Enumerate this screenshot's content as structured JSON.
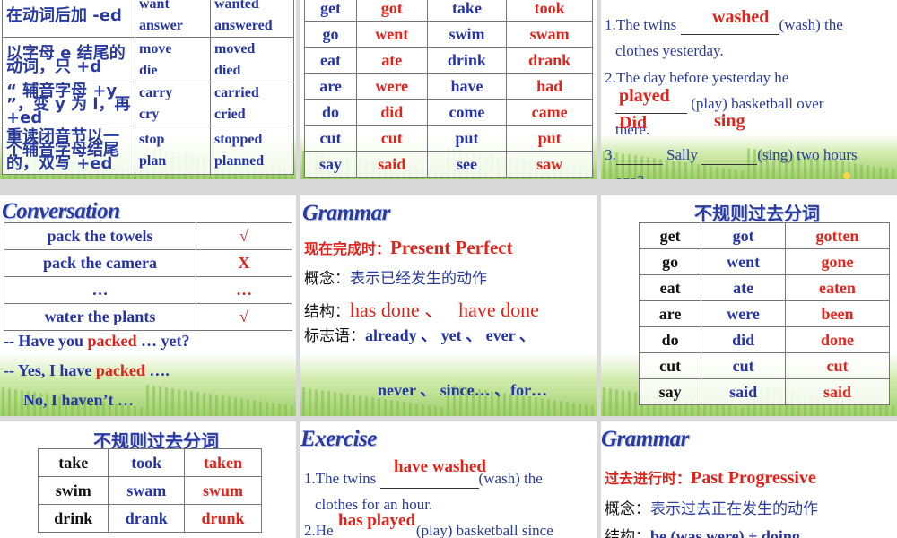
{
  "s1": {
    "rows": [
      {
        "rule": "在动词后加 -ed",
        "w1": "want",
        "w2": "answer",
        "p1": "wanted",
        "p2": "answered"
      },
      {
        "rule": "以字母 e  结尾的动词，只 +d",
        "w1": "move",
        "w2": "die",
        "p1": "moved",
        "p2": "died"
      },
      {
        "rule": "“  辅音字母 +y ”，变 y  为 i，再 +ed",
        "w1": "carry",
        "w2": "cry",
        "p1": "carried",
        "p2": "cried"
      },
      {
        "rule": "重读闭音节以一个辅音字母结尾的，双写 +ed",
        "w1": "stop",
        "w2": "plan",
        "p1": "stopped",
        "p2": "planned"
      }
    ]
  },
  "s2": {
    "rows": [
      [
        "get",
        "got",
        "take",
        "took"
      ],
      [
        "go",
        "went",
        "swim",
        "swam"
      ],
      [
        "eat",
        "ate",
        "drink",
        "drank"
      ],
      [
        "are",
        "were",
        "have",
        "had"
      ],
      [
        "do",
        "did",
        "come",
        "came"
      ],
      [
        "cut",
        "cut",
        "put",
        "put"
      ],
      [
        "say",
        "said",
        "see",
        "saw"
      ]
    ]
  },
  "s3": {
    "q1_pre": "1.The twins ",
    "q1_post": "(wash) the",
    "q1_line2": "clothes yesterday.",
    "q1_ans": "washed",
    "q2_line1": "2.The day before yesterday he",
    "q2_post": " (play) basketball over",
    "q2_line3": "there.",
    "q2_ans": "played",
    "q3_pre": "3.",
    "q3_mid": " Sally ",
    "q3_post": "(sing) two hours",
    "q3_line2": "ago?",
    "q3_ans1": "Did",
    "q3_ans2": "sing"
  },
  "s4": {
    "title": "Conversation",
    "rows": [
      {
        "item": "pack the towels",
        "mark": "√"
      },
      {
        "item": "pack the camera",
        "mark": "X"
      },
      {
        "item": "…",
        "mark": "…"
      },
      {
        "item": "water the plants",
        "mark": "√"
      }
    ],
    "l1_a": "-- Have you ",
    "l1_b": "packed",
    "l1_c": " … yet?",
    "l2_a": "-- Yes, I have ",
    "l2_b": "packed",
    "l2_c": " ….",
    "l3": "No, I haven’t …"
  },
  "s5": {
    "title": "Grammar",
    "label1": "现在完成时：",
    "label1_en": "Present Perfect",
    "k2": "概念：",
    "v2": "表示已经发生的动作",
    "k3": "结构：",
    "v3a": "has done 、",
    "v3b": "have done",
    "k4": "标志语：",
    "v4": "already 、  yet 、 ever 、",
    "v5": "never 、 since… 、for…"
  },
  "s6": {
    "title": "不规则过去分词",
    "rows": [
      [
        "get",
        "got",
        "gotten"
      ],
      [
        "go",
        "went",
        "gone"
      ],
      [
        "eat",
        "ate",
        "eaten"
      ],
      [
        "are",
        "were",
        "been"
      ],
      [
        "do",
        "did",
        "done"
      ],
      [
        "cut",
        "cut",
        "cut"
      ],
      [
        "say",
        "said",
        "said"
      ]
    ]
  },
  "s7": {
    "title": "不规则过去分词",
    "rows": [
      [
        "take",
        "took",
        "taken"
      ],
      [
        "swim",
        "swam",
        "swum"
      ],
      [
        "drink",
        "drank",
        "drunk"
      ]
    ]
  },
  "s8": {
    "title": "Exercise",
    "q1_pre": "1.The twins ",
    "q1_post": "(wash) the",
    "q1_line2": "clothes for an hour.",
    "q1_ans": "have washed",
    "q2_pre": "2.He ",
    "q2_post": "(play) basketball since",
    "q2_ans": "has played"
  },
  "s9": {
    "title": "Grammar",
    "label1": "过去进行时：",
    "label1_en": "Past Progressive",
    "k2": "概念：",
    "v2": "表示过去正在发生的动作",
    "k3": "结构：",
    "v3": "be (was    were) + doing"
  }
}
